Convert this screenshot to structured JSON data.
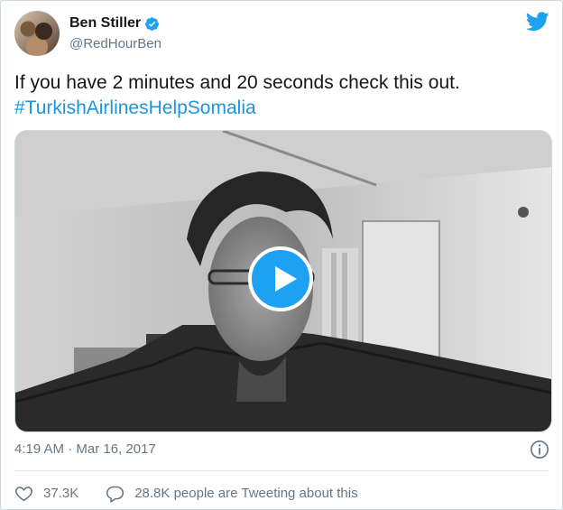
{
  "author": {
    "name": "Ben Stiller",
    "handle": "@RedHourBen",
    "verified": true
  },
  "tweet": {
    "text": "If you have 2 minutes and 20 seconds check this out.",
    "hashtag": "#TurkishAirlinesHelpSomalia"
  },
  "timestamp": "4:19 AM · Mar 16, 2017",
  "actions": {
    "likes": "37.3K",
    "tweeting": "28.8K people are Tweeting about this"
  },
  "colors": {
    "accent": "#1da1f2",
    "link": "#1b95e0",
    "muted": "#657786"
  },
  "icons": [
    "verified-badge-icon",
    "twitter-bird-icon",
    "play-icon",
    "info-icon",
    "heart-icon",
    "comment-icon"
  ]
}
